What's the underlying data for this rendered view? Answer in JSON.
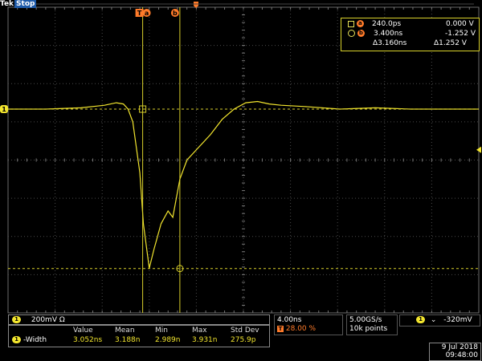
{
  "brand": {
    "name": "Tek",
    "run_state": "Stop"
  },
  "markers": {
    "trigger": "T",
    "cursor_a": "a",
    "cursor_b": "b",
    "channel": "1"
  },
  "readout": {
    "a_time": "240.0ps",
    "a_volt": "0.000 V",
    "b_time": "3.400ns",
    "b_volt": "-1.252 V",
    "delta_time": "Δ3.160ns",
    "delta_volt": "Δ1.252 V"
  },
  "channel": {
    "number": "1",
    "scale": "200mV",
    "coupling_symbol": "Ω",
    "color": "#f2e52e"
  },
  "measurement": {
    "name": "-Width",
    "headers": [
      "Value",
      "Mean",
      "Min",
      "Max",
      "Std Dev"
    ],
    "values": [
      "3.052ns",
      "3.188n",
      "2.989n",
      "3.931n",
      "275.9p"
    ]
  },
  "timebase": {
    "scale": "4.00ns",
    "position": "28.00 %"
  },
  "acquisition": {
    "rate": "5.00GS/s",
    "points": "10k points"
  },
  "trigger": {
    "channel": "1",
    "slope_symbol": "⌄",
    "level": "-320mV"
  },
  "datetime": {
    "date": "9 Jul  2018",
    "time": "09:48:00"
  },
  "chart_data": {
    "type": "line",
    "title": "",
    "xlabel": "",
    "ylabel": "",
    "x_unit": "ns",
    "y_unit": "V",
    "xlim": [
      -11.2,
      28.8
    ],
    "ylim": [
      -1.6,
      0.8
    ],
    "grid": true,
    "series": [
      {
        "x": [
          -11.2,
          -8.0,
          -5.0,
          -3.0,
          -2.0,
          -1.4,
          -1.0,
          -0.6,
          0.0,
          0.3,
          0.8,
          1.2,
          1.8,
          2.4,
          2.8,
          3.4,
          4.0,
          5.0,
          6.0,
          7.0,
          8.0,
          9.0,
          10.0,
          11.0,
          12.0,
          14.0,
          17.0,
          20.0,
          23.0,
          26.0,
          28.8
        ],
        "y": [
          0.0,
          0.0,
          0.01,
          0.03,
          0.05,
          0.04,
          0.0,
          -0.1,
          -0.5,
          -0.9,
          -1.25,
          -1.1,
          -0.9,
          -0.8,
          -0.85,
          -0.55,
          -0.4,
          -0.3,
          -0.2,
          -0.08,
          0.0,
          0.05,
          0.06,
          0.04,
          0.03,
          0.02,
          0.0,
          0.01,
          0.0,
          0.0,
          0.0
        ]
      }
    ],
    "cursors": {
      "a_time_ns": 0.24,
      "b_time_ns": 3.4,
      "a_volt": 0.0,
      "b_volt": -1.252
    }
  }
}
